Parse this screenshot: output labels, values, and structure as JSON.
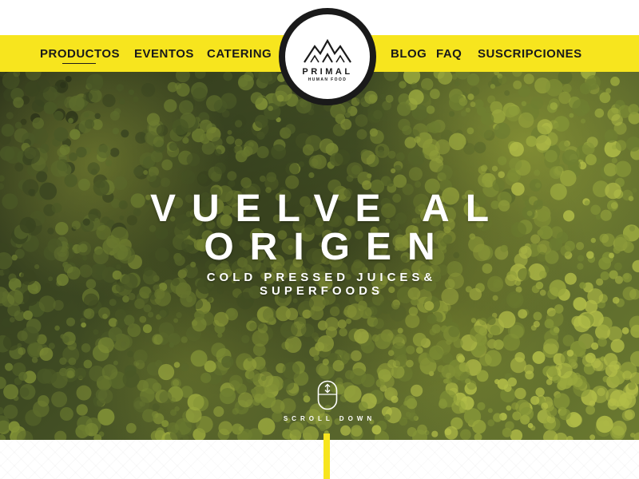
{
  "colors": {
    "brand_yellow": "#f7e51e",
    "ink": "#1a1a1a",
    "white": "#ffffff",
    "forest": "#3e4a22"
  },
  "nav": {
    "left": [
      {
        "label": "PRODUCTOS",
        "active": true
      },
      {
        "label": "EVENTOS"
      },
      {
        "label": "CATERING"
      }
    ],
    "right": [
      {
        "label": "BLOG"
      },
      {
        "label": "FAQ"
      },
      {
        "label": "SUSCRIPCIONES"
      }
    ]
  },
  "logo": {
    "name": "PRIMAL",
    "tagline": "HUMAN FOOD",
    "icon": "mountains-icon"
  },
  "hero": {
    "title_line1": "VUELVE AL",
    "title_line2": "ORIGEN",
    "subtitle_line1": "COLD PRESSED JUICES&",
    "subtitle_line2": "SUPERFOODS",
    "scroll_label": "SCROLL DOWN",
    "scroll_icon": "mouse-scroll-icon"
  }
}
